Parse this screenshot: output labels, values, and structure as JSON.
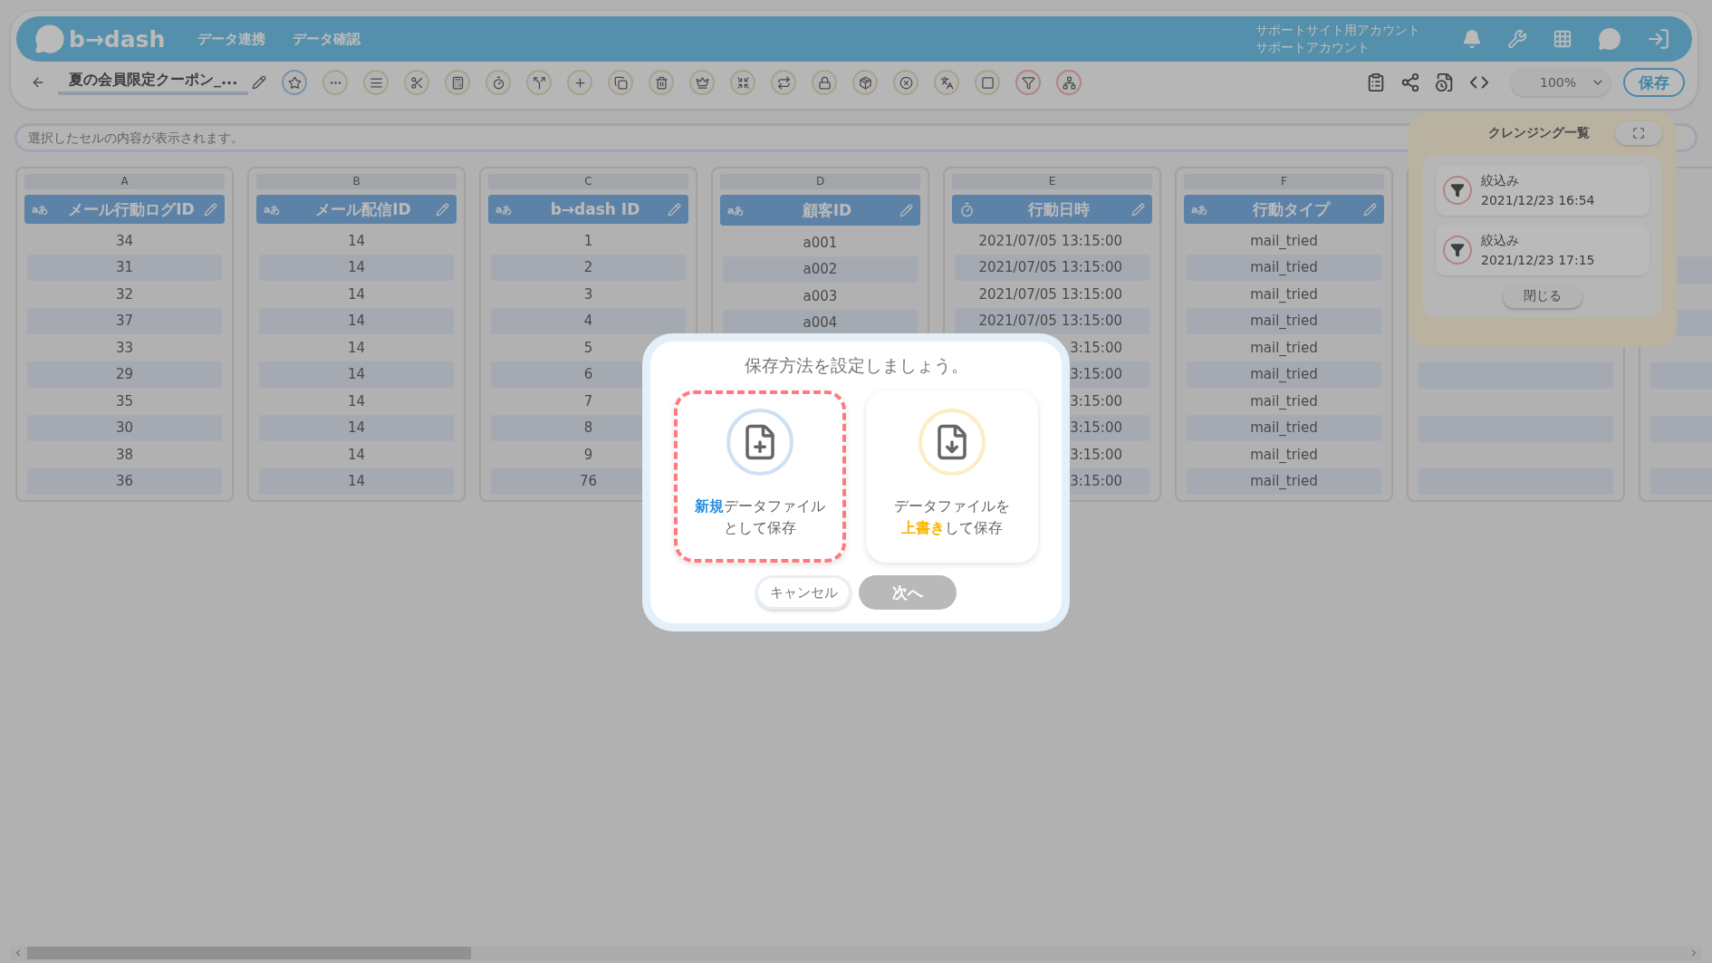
{
  "header": {
    "logo": "b→dash",
    "nav": [
      {
        "label": "データ連携"
      },
      {
        "label": "データ確認"
      }
    ],
    "account": [
      "サポートサイト用アカウント",
      "サポートアカウント"
    ]
  },
  "toolbar": {
    "title": "夏の会員限定クーポン_...",
    "zoom": "100%",
    "save": "保存"
  },
  "formula_bar": {
    "placeholder": "選択したセルの内容が表示されます。"
  },
  "columns": [
    {
      "letter": "A",
      "kind": "text",
      "type_label": "aあ",
      "name": "メール行動ログID",
      "cells": [
        "34",
        "31",
        "32",
        "37",
        "33",
        "29",
        "35",
        "30",
        "38",
        "36"
      ]
    },
    {
      "letter": "B",
      "kind": "text",
      "type_label": "aあ",
      "name": "メール配信ID",
      "cells": [
        "14",
        "14",
        "14",
        "14",
        "14",
        "14",
        "14",
        "14",
        "14",
        "14"
      ]
    },
    {
      "letter": "C",
      "kind": "text",
      "type_label": "aあ",
      "name": "b→dash ID",
      "cells": [
        "1",
        "2",
        "3",
        "4",
        "5",
        "6",
        "7",
        "8",
        "9",
        "76"
      ]
    },
    {
      "letter": "D",
      "kind": "text",
      "type_label": "aあ",
      "name": "顧客ID",
      "cells": [
        "a001",
        "a002",
        "a003",
        "a004"
      ]
    },
    {
      "letter": "E",
      "kind": "datetime",
      "name": "行動日時",
      "cells": [
        "2021/07/05 13:15:00",
        "2021/07/05 13:15:00",
        "2021/07/05 13:15:00",
        "2021/07/05 13:15:00",
        "3:15:00",
        "3:15:00",
        "3:15:00",
        "3:15:00",
        "3:15:00",
        "3:15:00"
      ]
    },
    {
      "letter": "F",
      "kind": "text",
      "type_label": "aあ",
      "name": "行動タイプ",
      "cells": [
        "mail_tried",
        "mail_tried",
        "mail_tried",
        "mail_tried",
        "mail_tried",
        "mail_tried",
        "mail_tried",
        "mail_tried",
        "mail_tried",
        "mail_tried"
      ]
    }
  ],
  "cleansing_panel": {
    "title": "クレンジング一覧",
    "items": [
      {
        "label": "絞込み",
        "time": "2021/12/23 16:54"
      },
      {
        "label": "絞込み",
        "time": "2021/12/23 17:15"
      }
    ],
    "close": "閉じる"
  },
  "modal": {
    "title": "保存方法を設定しましょう。",
    "options": [
      {
        "kind": "new",
        "selected": true,
        "color": "#cfe0f2",
        "lines": [
          "**新規**データファイル",
          "として保存"
        ]
      },
      {
        "kind": "overwrite",
        "selected": false,
        "color": "#fbeec4",
        "lines": [
          "データファイルを",
          "**上書き**して保存"
        ]
      }
    ],
    "cancel": "キャンセル",
    "next": {
      "label": "次へ",
      "disabled": true
    }
  }
}
